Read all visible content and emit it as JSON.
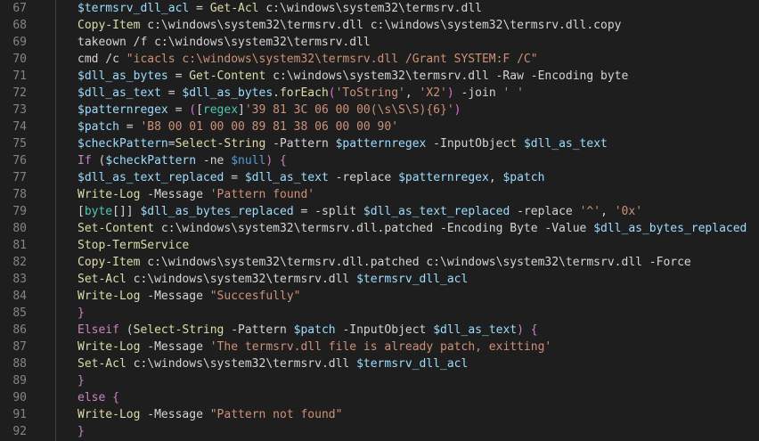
{
  "lines": [
    {
      "n": "67",
      "tokens": [
        {
          "t": "$termsrv_dll_acl",
          "c": "v"
        },
        {
          "t": " = ",
          "c": "p"
        },
        {
          "t": "Get-Acl",
          "c": "c"
        },
        {
          "t": " c:\\windows\\system32\\termsrv.dll",
          "c": "w"
        }
      ]
    },
    {
      "n": "68",
      "tokens": [
        {
          "t": "Copy-Item",
          "c": "c"
        },
        {
          "t": " c:\\windows\\system32\\termsrv.dll c:\\windows\\system32\\termsrv.dll.copy",
          "c": "w"
        }
      ]
    },
    {
      "n": "69",
      "tokens": [
        {
          "t": "takeown /f c:\\windows\\system32\\termsrv.dll",
          "c": "w"
        }
      ]
    },
    {
      "n": "70",
      "tokens": [
        {
          "t": "cmd /c ",
          "c": "w"
        },
        {
          "t": "\"icacls c:\\windows\\system32\\termsrv.dll /Grant SYSTEM:F /C\"",
          "c": "s"
        }
      ]
    },
    {
      "n": "71",
      "tokens": [
        {
          "t": "$dll_as_bytes",
          "c": "v"
        },
        {
          "t": " = ",
          "c": "p"
        },
        {
          "t": "Get-Content",
          "c": "c"
        },
        {
          "t": " c:\\windows\\system32\\termsrv.dll -Raw -Encoding byte",
          "c": "w"
        }
      ]
    },
    {
      "n": "72",
      "tokens": [
        {
          "t": "$dll_as_text",
          "c": "v"
        },
        {
          "t": " = ",
          "c": "p"
        },
        {
          "t": "$dll_as_bytes",
          "c": "v"
        },
        {
          "t": ".",
          "c": "p"
        },
        {
          "t": "forEach",
          "c": "c"
        },
        {
          "t": "(",
          "c": "br"
        },
        {
          "t": "'ToString'",
          "c": "s"
        },
        {
          "t": ", ",
          "c": "p"
        },
        {
          "t": "'X2'",
          "c": "s"
        },
        {
          "t": ")",
          "c": "br"
        },
        {
          "t": " -join ",
          "c": "w"
        },
        {
          "t": "' '",
          "c": "s"
        }
      ]
    },
    {
      "n": "73",
      "tokens": [
        {
          "t": "$patternregex",
          "c": "v"
        },
        {
          "t": " = ",
          "c": "p"
        },
        {
          "t": "(",
          "c": "br"
        },
        {
          "t": "[",
          "c": "p"
        },
        {
          "t": "regex",
          "c": "t"
        },
        {
          "t": "]",
          "c": "p"
        },
        {
          "t": "'39 81 3C 06 00 00(\\s\\S\\S){6}'",
          "c": "s"
        },
        {
          "t": ")",
          "c": "br"
        }
      ]
    },
    {
      "n": "74",
      "tokens": [
        {
          "t": "$patch",
          "c": "v"
        },
        {
          "t": " = ",
          "c": "p"
        },
        {
          "t": "'B8 00 01 00 00 89 81 38 06 00 00 90'",
          "c": "s"
        }
      ]
    },
    {
      "n": "75",
      "tokens": [
        {
          "t": "$checkPattern",
          "c": "v"
        },
        {
          "t": "=",
          "c": "p"
        },
        {
          "t": "Select-String",
          "c": "c"
        },
        {
          "t": " -Pattern ",
          "c": "w"
        },
        {
          "t": "$patternregex",
          "c": "v"
        },
        {
          "t": " -InputObject ",
          "c": "w"
        },
        {
          "t": "$dll_as_text",
          "c": "v"
        }
      ]
    },
    {
      "n": "76",
      "tokens": [
        {
          "t": "If",
          "c": "k"
        },
        {
          "t": " (",
          "c": "p"
        },
        {
          "t": "$checkPattern",
          "c": "v"
        },
        {
          "t": " -ne ",
          "c": "w"
        },
        {
          "t": "$null",
          "c": "b"
        },
        {
          "t": ") {",
          "c": "k"
        }
      ]
    },
    {
      "n": "77",
      "tokens": [
        {
          "t": "$dll_as_text_replaced",
          "c": "v"
        },
        {
          "t": " = ",
          "c": "p"
        },
        {
          "t": "$dll_as_text",
          "c": "v"
        },
        {
          "t": " -replace ",
          "c": "w"
        },
        {
          "t": "$patternregex",
          "c": "v"
        },
        {
          "t": ", ",
          "c": "p"
        },
        {
          "t": "$patch",
          "c": "v"
        }
      ]
    },
    {
      "n": "78",
      "tokens": [
        {
          "t": "Write-Log",
          "c": "c"
        },
        {
          "t": " -Message ",
          "c": "w"
        },
        {
          "t": "'Pattern found'",
          "c": "s"
        }
      ]
    },
    {
      "n": "79",
      "tokens": [
        {
          "t": "[",
          "c": "p"
        },
        {
          "t": "byte",
          "c": "t"
        },
        {
          "t": "[]]",
          "c": "p"
        },
        {
          "t": " ",
          "c": "p"
        },
        {
          "t": "$dll_as_bytes_replaced",
          "c": "v"
        },
        {
          "t": " = -split ",
          "c": "w"
        },
        {
          "t": "$dll_as_text_replaced",
          "c": "v"
        },
        {
          "t": " -replace ",
          "c": "w"
        },
        {
          "t": "'^'",
          "c": "s"
        },
        {
          "t": ", ",
          "c": "p"
        },
        {
          "t": "'0x'",
          "c": "s"
        }
      ]
    },
    {
      "n": "80",
      "tokens": [
        {
          "t": "Set-Content",
          "c": "c"
        },
        {
          "t": " c:\\windows\\system32\\termsrv.dll.patched -Encoding Byte -Value ",
          "c": "w"
        },
        {
          "t": "$dll_as_bytes_replaced",
          "c": "v"
        }
      ]
    },
    {
      "n": "81",
      "tokens": [
        {
          "t": "Stop-TermService",
          "c": "c"
        }
      ]
    },
    {
      "n": "82",
      "tokens": [
        {
          "t": "Copy-Item",
          "c": "c"
        },
        {
          "t": " c:\\windows\\system32\\termsrv.dll.patched c:\\windows\\system32\\termsrv.dll -Force",
          "c": "w"
        }
      ]
    },
    {
      "n": "83",
      "tokens": [
        {
          "t": "Set-Acl",
          "c": "c"
        },
        {
          "t": " c:\\windows\\system32\\termsrv.dll ",
          "c": "w"
        },
        {
          "t": "$termsrv_dll_acl",
          "c": "v"
        }
      ]
    },
    {
      "n": "84",
      "tokens": [
        {
          "t": "Write-Log",
          "c": "c"
        },
        {
          "t": " -Message ",
          "c": "w"
        },
        {
          "t": "\"Succesfully\"",
          "c": "s"
        }
      ]
    },
    {
      "n": "85",
      "tokens": [
        {
          "t": "}",
          "c": "k"
        }
      ]
    },
    {
      "n": "86",
      "tokens": [
        {
          "t": "Elseif",
          "c": "k"
        },
        {
          "t": " (",
          "c": "p"
        },
        {
          "t": "Select-String",
          "c": "c"
        },
        {
          "t": " -Pattern ",
          "c": "w"
        },
        {
          "t": "$patch",
          "c": "v"
        },
        {
          "t": " -InputObject ",
          "c": "w"
        },
        {
          "t": "$dll_as_text",
          "c": "v"
        },
        {
          "t": ") {",
          "c": "k"
        }
      ]
    },
    {
      "n": "87",
      "tokens": [
        {
          "t": "Write-Log",
          "c": "c"
        },
        {
          "t": " -Message ",
          "c": "w"
        },
        {
          "t": "'The termsrv.dll file is already patch, exitting'",
          "c": "s"
        }
      ]
    },
    {
      "n": "88",
      "tokens": [
        {
          "t": "Set-Acl",
          "c": "c"
        },
        {
          "t": " c:\\windows\\system32\\termsrv.dll ",
          "c": "w"
        },
        {
          "t": "$termsrv_dll_acl",
          "c": "v"
        }
      ]
    },
    {
      "n": "89",
      "tokens": [
        {
          "t": "}",
          "c": "k"
        }
      ]
    },
    {
      "n": "90",
      "tokens": [
        {
          "t": "else {",
          "c": "k"
        }
      ]
    },
    {
      "n": "91",
      "tokens": [
        {
          "t": "Write-Log",
          "c": "c"
        },
        {
          "t": " -Message ",
          "c": "w"
        },
        {
          "t": "\"Pattern not found\"",
          "c": "s"
        }
      ]
    },
    {
      "n": "92",
      "tokens": [
        {
          "t": "}",
          "c": "k"
        }
      ]
    }
  ]
}
